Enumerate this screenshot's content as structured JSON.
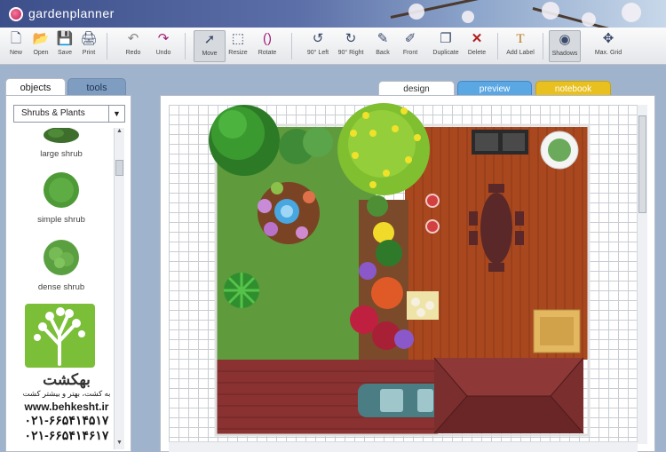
{
  "app": {
    "title": "gardenplanner"
  },
  "toolbar": {
    "new": "New",
    "open": "Open",
    "save": "Save",
    "print": "Print",
    "redo": "Redo",
    "undo": "Undo",
    "move": "Move",
    "resize": "Resize",
    "rotate": "Rotate",
    "rot_left": "90° Left",
    "rot_right": "90° Right",
    "back": "Back",
    "front": "Front",
    "duplicate": "Duplicate",
    "delete": "Delete",
    "add_label": "Add Label",
    "shadows": "Shadows",
    "max_grid": "Max. Grid"
  },
  "left_panel": {
    "tabs": [
      "objects",
      "tools"
    ],
    "category": "Shrubs & Plants",
    "objects": [
      {
        "label": "large shrub"
      },
      {
        "label": "simple shrub"
      },
      {
        "label": "dense shrub"
      }
    ]
  },
  "view_tabs": [
    "design",
    "preview",
    "notebook"
  ],
  "watermark": {
    "brand": "بهکشت",
    "tagline": "به کشت، بهتر و بیشتر کشت",
    "url": "www.behkesht.ir",
    "phone1": "۰۲۱-۶۶۵۴۱۴۵۱۷",
    "phone2": "۰۲۱-۶۶۵۴۱۴۶۱۷"
  },
  "colors": {
    "lawn": "#5f9a3c",
    "deck": "#a9481f",
    "paving": "#8a3232",
    "roof": "#7a2e2e",
    "car": "#4a7e84",
    "toolbar_icon": "#3a4a6a"
  },
  "icons": [
    "new-icon",
    "open-icon",
    "save-icon",
    "print-icon",
    "redo-icon",
    "undo-icon",
    "move-icon",
    "resize-icon",
    "rotate-icon",
    "rotate-left-icon",
    "rotate-right-icon",
    "back-icon",
    "front-icon",
    "duplicate-icon",
    "delete-icon",
    "add-label-icon",
    "shadows-icon",
    "max-grid-icon"
  ]
}
